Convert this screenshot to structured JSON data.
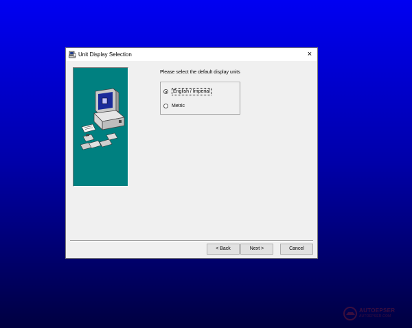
{
  "dialog": {
    "title": "Unit Display Selection",
    "close_label": "×",
    "prompt": "Please select the default display units",
    "options": [
      {
        "label": "English / Imperial",
        "checked": true
      },
      {
        "label": "Metric",
        "checked": false
      }
    ],
    "buttons": {
      "back_label": "< Back",
      "next_label": "Next >",
      "cancel_label": "Cancel"
    }
  },
  "watermark": {
    "line1": "AUTOEPSER",
    "line2": "AUTOEPSER.COM"
  },
  "colors": {
    "desktop_top": "#0000f2",
    "desktop_bottom": "#000040",
    "side_panel": "#008080",
    "dialog_bg": "#f0f0f0"
  },
  "icons": {
    "title": "setup-computer-icon",
    "close": "close-icon",
    "illustration": "computer-disks-illustration"
  }
}
